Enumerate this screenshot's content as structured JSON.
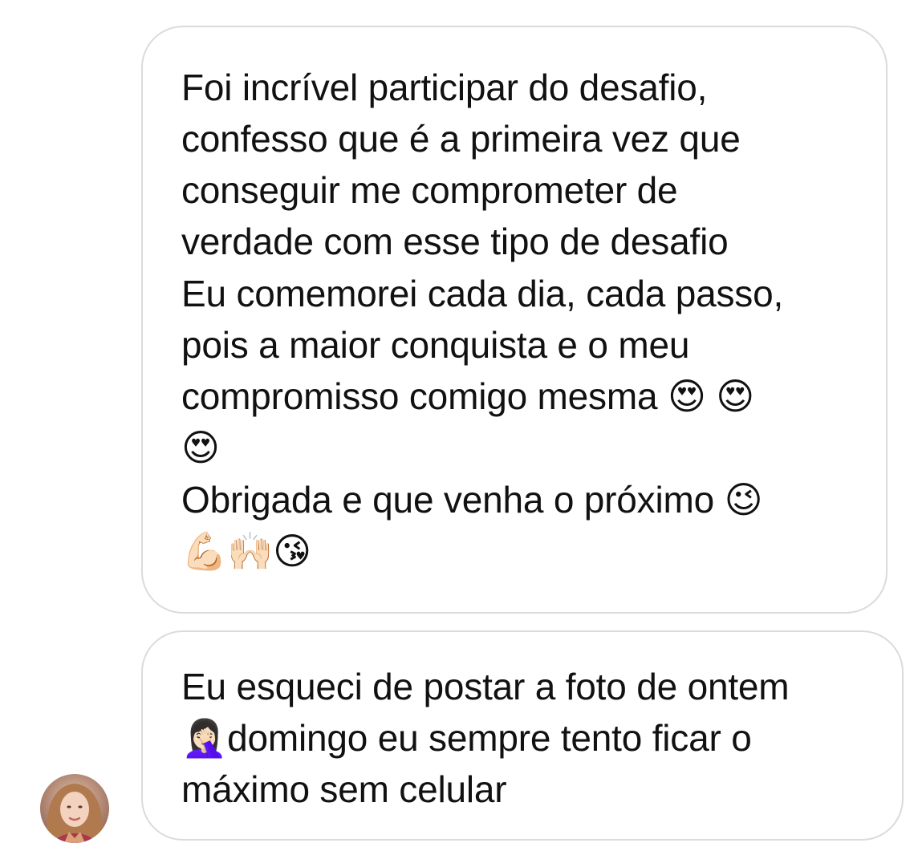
{
  "messages": [
    {
      "paragraphs": [
        "Foi incrível participar do desafio,\nconfesso que é a primeira vez que\nconseguir me comprometer de\nverdade com esse tipo de desafio",
        "Eu comemorei cada dia, cada passo,\npois a maior conquista e o meu\ncompromisso comigo mesma 😍 😍\n😍",
        "Obrigada e que venha o próximo 😉\n💪🏻🙌🏻😘"
      ]
    },
    {
      "paragraphs": [
        "Eu esqueci de postar a foto de ontem\n🤦🏻‍♀️domingo eu sempre tento ficar o\nmáximo sem celular"
      ]
    }
  ],
  "avatar": {
    "icon": "user-avatar-photo"
  }
}
